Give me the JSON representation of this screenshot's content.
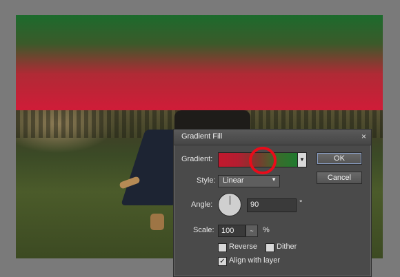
{
  "dialog": {
    "title": "Gradient Fill",
    "close_glyph": "×",
    "gradient_label": "Gradient:",
    "style_label": "Style:",
    "style_value": "Linear",
    "angle_label": "Angle:",
    "angle_value": "90",
    "angle_unit": "°",
    "scale_label": "Scale:",
    "scale_value": "100",
    "scale_unit": "%",
    "reverse_label": "Reverse",
    "dither_label": "Dither",
    "align_label": "Align with layer",
    "reverse_checked": false,
    "dither_checked": false,
    "align_checked": true,
    "ok_label": "OK",
    "cancel_label": "Cancel",
    "gradient_colors": [
      "#c2182e",
      "#1f7a2e"
    ]
  },
  "icons": {
    "close": "close-icon",
    "dropdown": "chevron-down-icon",
    "checkmark": "checkmark-icon"
  },
  "colors": {
    "fill_top": "#1c6b2d",
    "fill_bottom": "#d01c38",
    "highlight_circle": "#ea0b1a"
  }
}
